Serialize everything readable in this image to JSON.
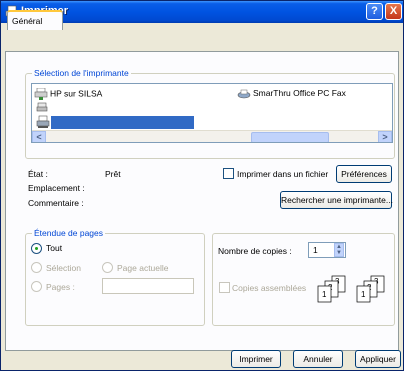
{
  "window": {
    "title": "Imprimer",
    "help_btn": "?",
    "close_btn": "X"
  },
  "tabs": [
    {
      "label": "Général"
    }
  ],
  "printer_selection": {
    "legend": "Sélection de l'imprimante",
    "printers": [
      {
        "name": "HP sur SILSA",
        "icon": "network-printer-icon"
      },
      {
        "name": "SmarThru Office PC Fax",
        "icon": "fax-icon"
      }
    ],
    "scroll_left": "<",
    "scroll_right": ">"
  },
  "status": {
    "etat_label": "État :",
    "etat_value": "Prêt",
    "emplacement_label": "Emplacement :",
    "commentaire_label": "Commentaire :",
    "print_to_file_label": "Imprimer dans un fichier",
    "preferences_label": "Préférences",
    "find_printer_label": "Rechercher une imprimante..."
  },
  "page_range": {
    "legend": "Étendue de pages",
    "all": "Tout",
    "selection": "Sélection",
    "current_page": "Page actuelle",
    "pages": "Pages :"
  },
  "copies": {
    "count_label": "Nombre de copies :",
    "count_value": "1",
    "collate_label": "Copies assemblées"
  },
  "footer": {
    "print": "Imprimer",
    "cancel": "Annuler",
    "apply": "Appliquer"
  }
}
